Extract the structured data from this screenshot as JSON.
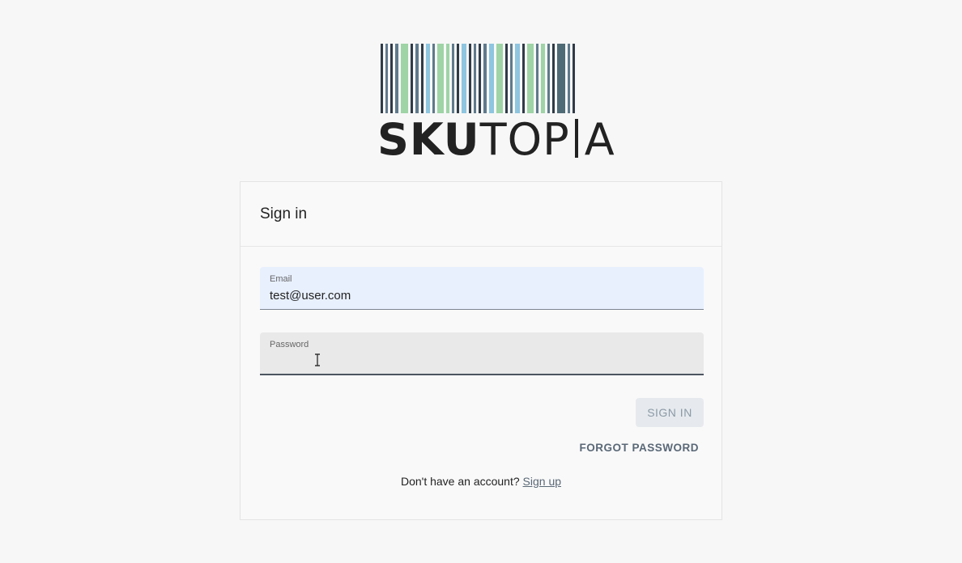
{
  "brand": {
    "name_bold": "SKU",
    "name_light": "TOP",
    "name_tail": "A",
    "bar_colors": {
      "dark": "#2f3b47",
      "slate": "#5f7a8c",
      "green": "#9fd4a6",
      "blue": "#8ec5df",
      "teal": "#4f6b76"
    },
    "barcode": [
      {
        "c": "dark",
        "w": 3
      },
      {
        "c": "slate",
        "w": 3
      },
      {
        "c": "dark",
        "w": 3
      },
      {
        "c": "slate",
        "w": 4
      },
      {
        "c": "green",
        "w": 9
      },
      {
        "c": "dark",
        "w": 3
      },
      {
        "c": "slate",
        "w": 4
      },
      {
        "c": "dark",
        "w": 3
      },
      {
        "c": "blue",
        "w": 5
      },
      {
        "c": "slate",
        "w": 3
      },
      {
        "c": "green",
        "w": 8
      },
      {
        "c": "green",
        "w": 4
      },
      {
        "c": "slate",
        "w": 3
      },
      {
        "c": "dark",
        "w": 3
      },
      {
        "c": "blue",
        "w": 6
      },
      {
        "c": "dark",
        "w": 3
      },
      {
        "c": "slate",
        "w": 3
      },
      {
        "c": "dark",
        "w": 3
      },
      {
        "c": "slate",
        "w": 4
      },
      {
        "c": "blue",
        "w": 6
      },
      {
        "c": "green",
        "w": 8
      },
      {
        "c": "dark",
        "w": 3
      },
      {
        "c": "slate",
        "w": 3
      },
      {
        "c": "blue",
        "w": 6
      },
      {
        "c": "dark",
        "w": 3
      },
      {
        "c": "green",
        "w": 8
      },
      {
        "c": "slate",
        "w": 3
      },
      {
        "c": "green",
        "w": 5
      },
      {
        "c": "slate",
        "w": 3
      },
      {
        "c": "dark",
        "w": 3
      },
      {
        "c": "teal",
        "w": 10
      },
      {
        "c": "slate",
        "w": 3
      },
      {
        "c": "dark",
        "w": 3
      }
    ]
  },
  "signin": {
    "title": "Sign in",
    "email_label": "Email",
    "email_value": "test@user.com",
    "password_label": "Password",
    "password_value": "",
    "submit_label": "SIGN IN",
    "forgot_label": "FORGOT PASSWORD",
    "signup_prompt": "Don't have an account?",
    "signup_link": "Sign up"
  }
}
